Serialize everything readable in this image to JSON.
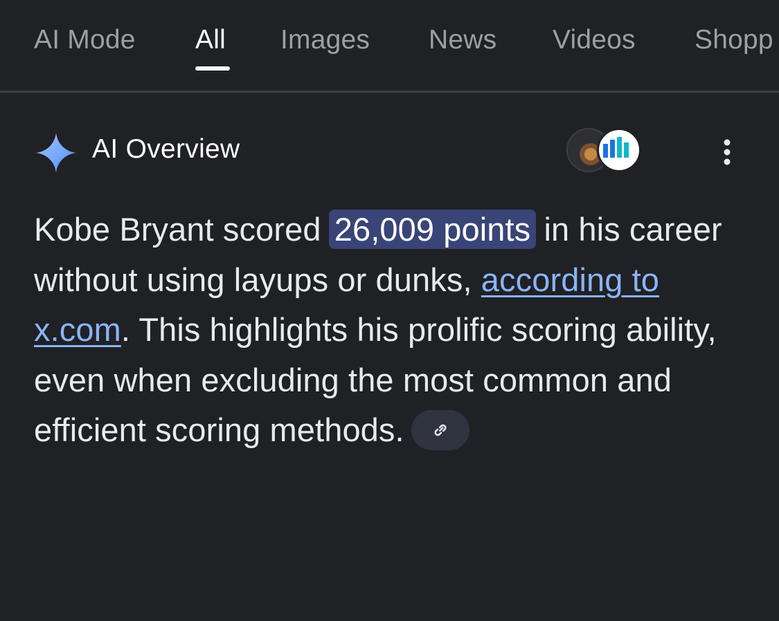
{
  "tabs": [
    {
      "label": "AI Mode"
    },
    {
      "label": "All"
    },
    {
      "label": "Images"
    },
    {
      "label": "News"
    },
    {
      "label": "Videos"
    },
    {
      "label": "Shopp"
    }
  ],
  "active_tab": "All",
  "overview": {
    "title": "AI Overview",
    "icon": "sparkle-icon",
    "accent_color": "#8ab4f8",
    "highlight_color": "#394477",
    "avatars": [
      "source-avatar-photo",
      "source-avatar-chart"
    ],
    "menu_icon": "more-vert-icon",
    "text_1": "Kobe Bryant scored ",
    "highlight": "26,009 points",
    "text_2": " in his career without using layups or dunks, ",
    "link_text": "according to x.com",
    "text_3": ". This highlights his prolific scoring ability, even when excluding the most common and efficient scoring methods.",
    "link_chip_icon": "link-icon"
  }
}
